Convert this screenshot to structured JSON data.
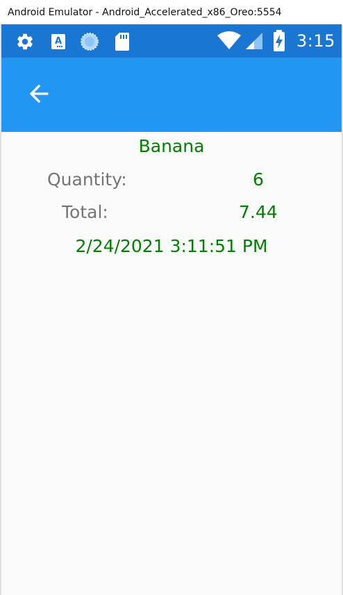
{
  "window": {
    "title": "Android Emulator - Android_Accelerated_x86_Oreo:5554"
  },
  "status_bar": {
    "time": "3:15",
    "left_icons": [
      "gear-icon",
      "text-a-icon",
      "sync-circle-icon",
      "sd-card-icon"
    ],
    "right_icons": [
      "wifi-icon",
      "cell-signal-icon",
      "battery-charging-icon"
    ],
    "background": "#1976d2"
  },
  "action_bar": {
    "back_icon": "arrow-left-icon",
    "background": "#2196f3"
  },
  "detail": {
    "product_name": "Banana",
    "quantity_label": "Quantity:",
    "quantity_value": "6",
    "total_label": "Total:",
    "total_value": "7.44",
    "timestamp": "2/24/2021 3:11:51 PM",
    "value_color": "#008000",
    "label_color": "#757575"
  }
}
